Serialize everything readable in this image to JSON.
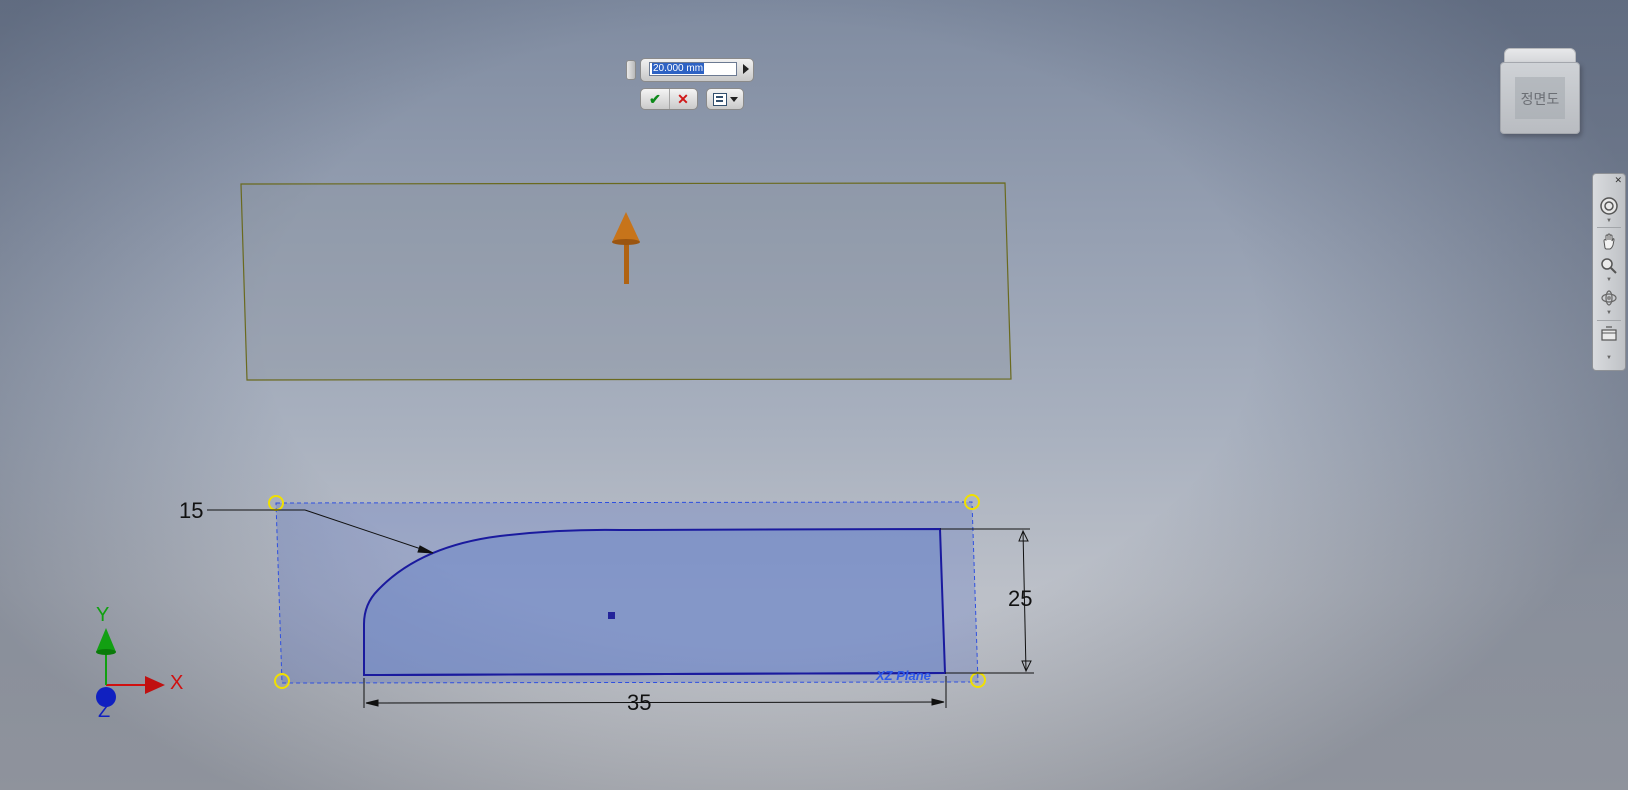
{
  "mini_toolbar": {
    "distance_value": "20.000 mm",
    "ok_glyph": "✔",
    "cancel_glyph": "✕",
    "options_icon": "table-options-icon",
    "chevron_icon": "chevron-down-icon"
  },
  "viewcube": {
    "face_label": "정면도"
  },
  "navigation_bar": {
    "items": [
      {
        "icon": "steering-wheel-icon"
      },
      {
        "icon": "pan-hand-icon"
      },
      {
        "icon": "zoom-icon"
      },
      {
        "icon": "orbit-icon"
      },
      {
        "icon": "view-face-icon"
      }
    ]
  },
  "sketch": {
    "dim_left": "15",
    "dim_height": "25",
    "dim_width": "35",
    "plane_label": "XZ Plane"
  },
  "axes": {
    "x_label": "X",
    "y_label": "Y",
    "z_label": "Z"
  },
  "colors": {
    "extrude_arrow": "#c7741a",
    "preview_plane_border": "#6a6a1e",
    "sketch_fill": "#6f86c8",
    "sketch_outline": "#1a1a9e",
    "dashed_boundary": "#2e4fe0",
    "grip_circle": "#f0e000",
    "axis_x": "#d01010",
    "axis_y": "#10a010",
    "axis_z": "#1020c0"
  }
}
